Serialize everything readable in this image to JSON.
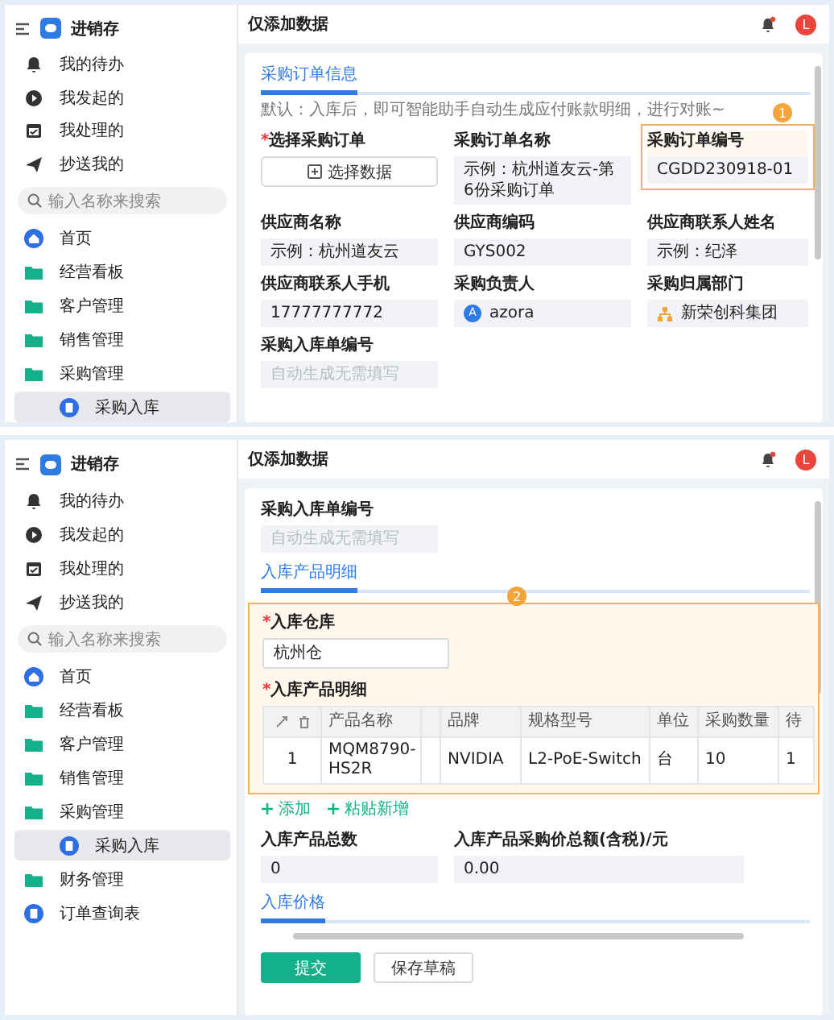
{
  "panels": [
    {
      "app": {
        "title": "进销存"
      },
      "quick_links": [
        {
          "label": "我的待办",
          "kind": "bell"
        },
        {
          "label": "我发起的",
          "kind": "play"
        },
        {
          "label": "我处理的",
          "kind": "check"
        },
        {
          "label": "抄送我的",
          "kind": "send"
        }
      ],
      "search": {
        "placeholder": "输入名称来搜索"
      },
      "nav": [
        {
          "label": "首页",
          "kind": "home",
          "selected": false
        },
        {
          "label": "经营看板",
          "kind": "folder",
          "selected": false
        },
        {
          "label": "客户管理",
          "kind": "folder",
          "selected": false
        },
        {
          "label": "销售管理",
          "kind": "folder",
          "selected": false
        },
        {
          "label": "采购管理",
          "kind": "folder",
          "selected": false,
          "children": [
            {
              "label": "采购入库",
              "kind": "doc",
              "selected": true
            }
          ]
        }
      ],
      "header": {
        "title": "仅添加数据",
        "avatar": "L"
      },
      "blocks": [
        {
          "kind": "tab",
          "label": "采购订单信息",
          "hint": "默认：入库后，即可智能助手自动生成应付账款明细，进行对账~"
        },
        {
          "kind": "grid",
          "fields": [
            {
              "label": "选择采购订单",
              "mark": "*",
              "kind": "button",
              "value": "选择数据"
            },
            {
              "label": "采购订单名称",
              "kind": "text",
              "value": "示例：杭州道友云-第6份采购订单"
            },
            {
              "label": "采购订单编号",
              "kind": "text",
              "value": "CGDD230918-01",
              "callout": "1"
            },
            {
              "label": "供应商名称",
              "kind": "text",
              "value": "示例：杭州道友云"
            },
            {
              "label": "供应商编码",
              "kind": "text",
              "value": "GYS002"
            },
            {
              "label": "供应商联系人姓名",
              "kind": "text",
              "value": "示例：纪泽"
            },
            {
              "label": "供应商联系人手机",
              "kind": "text",
              "value": "17777777772"
            },
            {
              "label": "采购负责人",
              "kind": "person",
              "value": "azora",
              "initial": "A"
            },
            {
              "label": "采购归属部门",
              "kind": "dept",
              "value": "新荣创科集团"
            },
            {
              "label": "采购入库单编号",
              "kind": "text",
              "placeholder": "自动生成无需填写"
            }
          ]
        }
      ]
    },
    {
      "app": {
        "title": "进销存"
      },
      "quick_links": [
        {
          "label": "我的待办",
          "kind": "bell"
        },
        {
          "label": "我发起的",
          "kind": "play"
        },
        {
          "label": "我处理的",
          "kind": "check"
        },
        {
          "label": "抄送我的",
          "kind": "send"
        }
      ],
      "search": {
        "placeholder": "输入名称来搜索"
      },
      "nav": [
        {
          "label": "首页",
          "kind": "home",
          "selected": false
        },
        {
          "label": "经营看板",
          "kind": "folder",
          "selected": false
        },
        {
          "label": "客户管理",
          "kind": "folder",
          "selected": false
        },
        {
          "label": "销售管理",
          "kind": "folder",
          "selected": false
        },
        {
          "label": "采购管理",
          "kind": "folder",
          "selected": false,
          "children": [
            {
              "label": "采购入库",
              "kind": "doc",
              "selected": true
            }
          ]
        },
        {
          "label": "财务管理",
          "kind": "folder",
          "selected": false
        },
        {
          "label": "订单查询表",
          "kind": "doc",
          "selected": false
        }
      ],
      "header": {
        "title": "仅添加数据",
        "avatar": "L"
      },
      "blocks": [
        {
          "kind": "grid",
          "fields": [
            {
              "label": "采购入库单编号",
              "kind": "text",
              "placeholder": "自动生成无需填写"
            }
          ]
        },
        {
          "kind": "tab",
          "label": "入库产品明细"
        },
        {
          "kind": "callout",
          "badge": "2",
          "blocks": [
            {
              "kind": "grid",
              "fields": [
                {
                  "label": "入库仓库",
                  "mark": "*",
                  "kind": "input",
                  "value": "杭州仓"
                }
              ]
            },
            {
              "kind": "table",
              "label": "入库产品明细",
              "mark": "*",
              "columns": [
                "产品名称",
                "",
                "品牌",
                "规格型号",
                "单位",
                "采购数量",
                "待"
              ],
              "rows": [
                {
                  "index": "1",
                  "cells": [
                    "MQM8790-HS2R",
                    "",
                    "NVIDIA",
                    "L2-PoE-Switch",
                    "台",
                    "10",
                    "1"
                  ]
                }
              ]
            }
          ]
        },
        {
          "kind": "links",
          "items": [
            "添加",
            "粘贴新增"
          ]
        },
        {
          "kind": "grid",
          "fields": [
            {
              "label": "入库产品总数",
              "kind": "text",
              "value": "0"
            },
            {
              "label": "入库产品采购价总额(含税)/元",
              "kind": "text",
              "value": "0.00"
            }
          ]
        },
        {
          "kind": "tab",
          "label": "入库价格"
        },
        {
          "kind": "actions",
          "buttons": [
            {
              "label": "提交",
              "primary": true
            },
            {
              "label": "保存草稿",
              "primary": false
            }
          ]
        }
      ]
    }
  ]
}
